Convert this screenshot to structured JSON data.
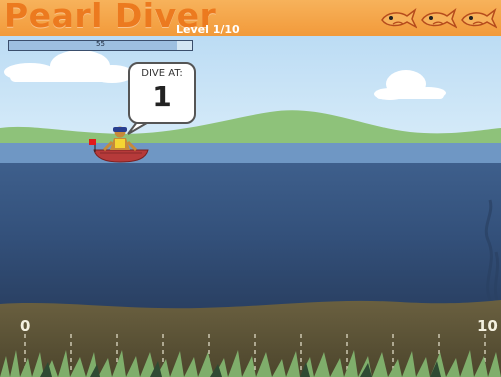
{
  "game": {
    "title": "Pearl Diver",
    "level": "Level 1/10",
    "lives_count": 3,
    "life_icon": "fish-life-icon",
    "meter": {
      "value_text": "55",
      "fill_fraction": 0.92
    },
    "prompt": {
      "label": "DIVE AT:",
      "value": "1"
    },
    "depth_axis": {
      "min_label": "0",
      "max_label": "10",
      "tick_count": 11
    },
    "colors": {
      "header": "#f29a3a",
      "title": "#ec7a1f",
      "sky": "#c3e0f5",
      "water_surface": "#6f97c4",
      "water_deep": "#2c4569",
      "seabed": "#5b5336",
      "grass": "#8ec27a",
      "boat": "#b63a3a"
    }
  }
}
